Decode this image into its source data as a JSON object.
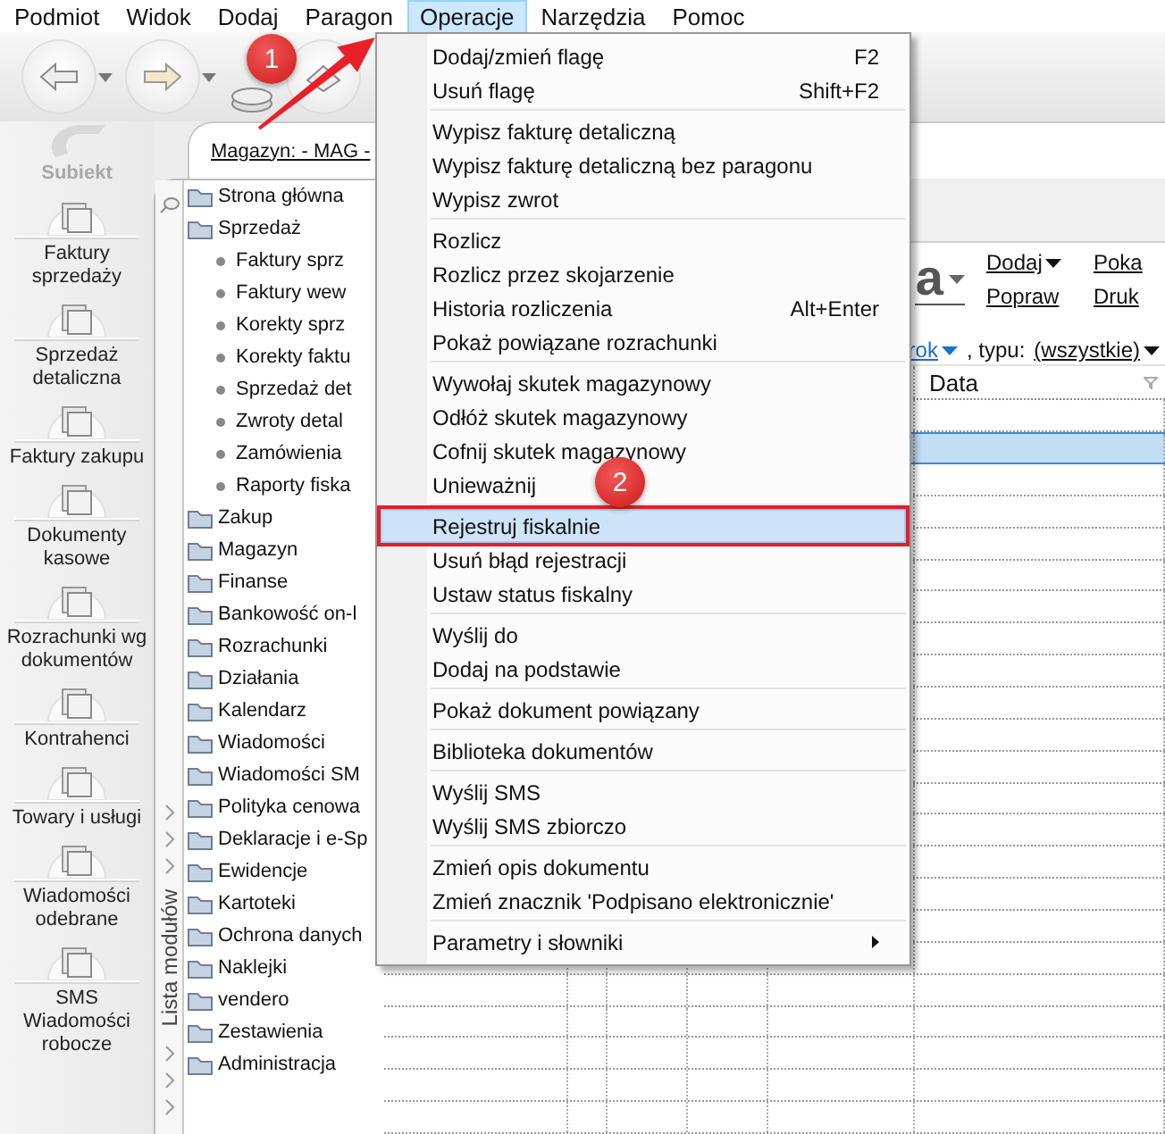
{
  "menu_bar": [
    {
      "label": "Podmiot",
      "selected": false
    },
    {
      "label": "Widok",
      "selected": false
    },
    {
      "label": "Dodaj",
      "selected": false
    },
    {
      "label": "Paragon",
      "selected": false
    },
    {
      "label": "Operacje",
      "selected": true
    },
    {
      "label": "Narzędzia",
      "selected": false
    },
    {
      "label": "Pomoc",
      "selected": false
    }
  ],
  "sidebar": {
    "logo": "Subiekt",
    "items": [
      {
        "label": "Faktury sprzedaży"
      },
      {
        "label": "Sprzedaż detaliczna"
      },
      {
        "label": "Faktury zakupu"
      },
      {
        "label": "Dokumenty kasowe"
      },
      {
        "label": "Rozrachunki wg dokumentów"
      },
      {
        "label": "Kontrahenci"
      },
      {
        "label": "Towary i usługi"
      },
      {
        "label": "Wiadomości odebrane"
      },
      {
        "label": "SMS Wiadomości robocze"
      }
    ]
  },
  "header": {
    "warehouse": "Magazyn: - MAG -"
  },
  "module_panel": {
    "title": "Lista modułów",
    "items": [
      {
        "label": "Strona główna"
      },
      {
        "label": "Sprzedaż",
        "children": [
          {
            "label": "Faktury sprz"
          },
          {
            "label": "Faktury wew"
          },
          {
            "label": "Korekty sprz"
          },
          {
            "label": "Korekty faktu"
          },
          {
            "label": "Sprzedaż det"
          },
          {
            "label": "Zwroty detal"
          },
          {
            "label": "Zamówienia"
          },
          {
            "label": "Raporty fiska"
          }
        ]
      },
      {
        "label": "Zakup"
      },
      {
        "label": "Magazyn"
      },
      {
        "label": "Finanse"
      },
      {
        "label": "Bankowość on-l"
      },
      {
        "label": "Rozrachunki"
      },
      {
        "label": "Działania"
      },
      {
        "label": "Kalendarz"
      },
      {
        "label": "Wiadomości"
      },
      {
        "label": "Wiadomości SM"
      },
      {
        "label": "Polityka cenowa"
      },
      {
        "label": "Deklaracje i e-Sp"
      },
      {
        "label": "Ewidencje"
      },
      {
        "label": "Kartoteki"
      },
      {
        "label": "Ochrona danych"
      },
      {
        "label": "Naklejki"
      },
      {
        "label": "vendero"
      },
      {
        "label": "Zestawienia"
      },
      {
        "label": "Administracja"
      }
    ]
  },
  "document_view": {
    "title": "a",
    "actions": [
      {
        "label": "Dodaj",
        "dropdown": true
      },
      {
        "label": "Popraw",
        "dropdown": false
      },
      {
        "label": "Poka",
        "dropdown": false
      },
      {
        "label": "Druk",
        "dropdown": false
      }
    ],
    "filter": {
      "period": "rok",
      "type_label": ", typu:",
      "type_value": "(wszystkie)"
    },
    "table": {
      "columns": [
        "Data"
      ],
      "rows": [
        {
          "selected": false
        },
        {
          "selected": true
        },
        {
          "selected": false
        },
        {
          "selected": false
        },
        {
          "selected": false
        },
        {
          "selected": false
        },
        {
          "selected": false
        },
        {
          "selected": false
        },
        {
          "selected": false
        },
        {
          "selected": false
        },
        {
          "selected": false
        },
        {
          "selected": false
        },
        {
          "selected": false
        },
        {
          "selected": false
        },
        {
          "selected": false
        },
        {
          "selected": false
        },
        {
          "selected": false
        },
        {
          "selected": false
        },
        {
          "selected": false
        },
        {
          "selected": false
        },
        {
          "selected": false
        },
        {
          "selected": false
        },
        {
          "selected": false
        }
      ]
    }
  },
  "operations_menu": {
    "groups": [
      [
        {
          "label": "Dodaj/zmień flagę",
          "shortcut": "F2",
          "selected": false,
          "outlined": false,
          "submenu": false
        },
        {
          "label": "Usuń flagę",
          "shortcut": "Shift+F2",
          "selected": false,
          "outlined": false,
          "submenu": false
        }
      ],
      [
        {
          "label": "Wypisz fakturę detaliczną",
          "selected": false,
          "outlined": false,
          "submenu": false
        },
        {
          "label": "Wypisz fakturę detaliczną bez paragonu",
          "selected": false,
          "outlined": false,
          "submenu": false
        },
        {
          "label": "Wypisz zwrot",
          "selected": false,
          "outlined": false,
          "submenu": false
        }
      ],
      [
        {
          "label": "Rozlicz",
          "selected": false,
          "outlined": false,
          "submenu": false
        },
        {
          "label": "Rozlicz przez skojarzenie",
          "selected": false,
          "outlined": false,
          "submenu": false
        },
        {
          "label": "Historia rozliczenia",
          "shortcut": "Alt+Enter",
          "selected": false,
          "outlined": false,
          "submenu": false
        },
        {
          "label": "Pokaż powiązane rozrachunki",
          "selected": false,
          "outlined": false,
          "submenu": false
        }
      ],
      [
        {
          "label": "Wywołaj skutek magazynowy",
          "selected": false,
          "outlined": false,
          "submenu": false
        },
        {
          "label": "Odłóż skutek magazynowy",
          "selected": false,
          "outlined": false,
          "submenu": false
        },
        {
          "label": "Cofnij skutek magazynowy",
          "selected": false,
          "outlined": false,
          "submenu": false
        },
        {
          "label": "Unieważnij",
          "selected": false,
          "outlined": false,
          "submenu": false
        }
      ],
      [
        {
          "label": "Rejestruj fiskalnie",
          "selected": true,
          "outlined": true,
          "submenu": false
        },
        {
          "label": "Usuń błąd rejestracji",
          "selected": false,
          "outlined": false,
          "submenu": false
        },
        {
          "label": "Ustaw status fiskalny",
          "selected": false,
          "outlined": false,
          "submenu": false
        }
      ],
      [
        {
          "label": "Wyślij do",
          "selected": false,
          "outlined": false,
          "submenu": false
        },
        {
          "label": "Dodaj na podstawie",
          "selected": false,
          "outlined": false,
          "submenu": false
        }
      ],
      [
        {
          "label": "Pokaż dokument powiązany",
          "selected": false,
          "outlined": false,
          "submenu": false
        }
      ],
      [
        {
          "label": "Biblioteka dokumentów",
          "selected": false,
          "outlined": false,
          "submenu": false
        }
      ],
      [
        {
          "label": "Wyślij SMS",
          "selected": false,
          "outlined": false,
          "submenu": false
        },
        {
          "label": "Wyślij SMS zbiorczo",
          "selected": false,
          "outlined": false,
          "submenu": false
        }
      ],
      [
        {
          "label": "Zmień opis dokumentu",
          "selected": false,
          "outlined": false,
          "submenu": false
        },
        {
          "label": "Zmień znacznik 'Podpisano elektronicznie'",
          "selected": false,
          "outlined": false,
          "submenu": false
        }
      ],
      [
        {
          "label": "Parametry i słowniki",
          "selected": false,
          "outlined": false,
          "submenu": true
        }
      ]
    ]
  },
  "annotations": {
    "badges": [
      {
        "label": "1"
      },
      {
        "label": "2"
      }
    ]
  }
}
